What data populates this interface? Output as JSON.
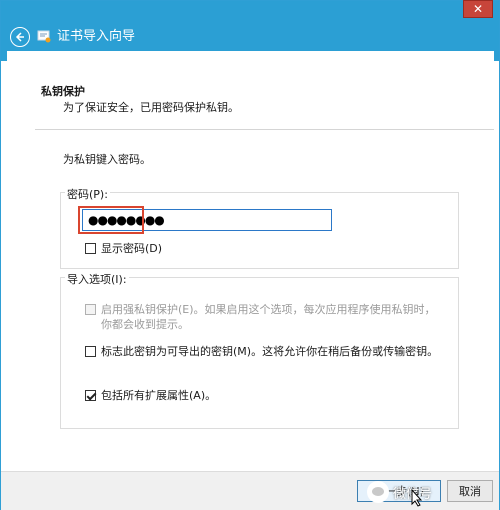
{
  "window": {
    "title": "证书导入向导",
    "close_glyph": "✕",
    "accent": "#2b9fd4"
  },
  "section": {
    "title": "私钥保护",
    "description": "为了保证安全，已用密码保护私钥。"
  },
  "prompt": "为私钥键入密码。",
  "password_group": {
    "label": "密码(P):",
    "value": "●●●●●●●●",
    "show_password": {
      "label": "显示密码(D)",
      "checked": false
    }
  },
  "import_options": {
    "label": "导入选项(I):",
    "options": [
      {
        "label": "启用强私钥保护(E)。如果启用这个选项，每次应用程序使用私钥时，你都会收到提示。",
        "checked": false,
        "enabled": false
      },
      {
        "label": "标志此密钥为可导出的密钥(M)。这将允许你在稍后备份或传输密钥。",
        "checked": false,
        "enabled": true
      },
      {
        "label": "包括所有扩展属性(A)。",
        "checked": true,
        "enabled": true
      }
    ]
  },
  "footer": {
    "next_label": "下一步(N)",
    "cancel_label": "取消"
  },
  "watermark": {
    "text": "微信号"
  },
  "highlight_color": "#d9452f"
}
